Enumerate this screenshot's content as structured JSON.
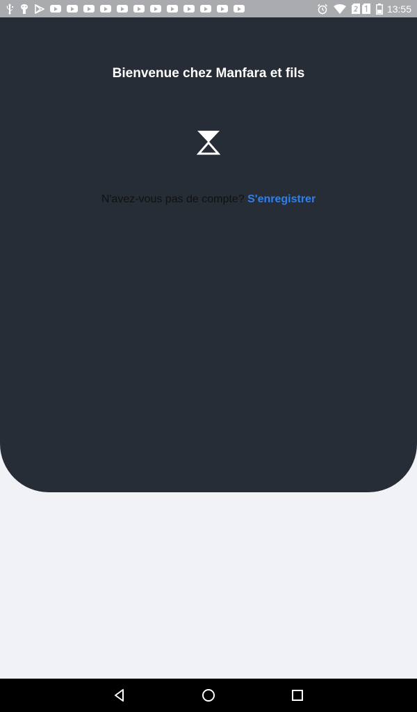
{
  "status_bar": {
    "time": "13:55",
    "left_icons": [
      "usb-icon",
      "android-debug-icon",
      "play-store-icon"
    ],
    "youtube_notification_count": 12,
    "right_icons": [
      "alarm-icon",
      "wifi-icon",
      "sim-2-icon",
      "sim-1-icon",
      "battery-icon"
    ]
  },
  "hero": {
    "title": "Bienvenue chez Manfara et fils",
    "loader_icon": "hourglass-icon"
  },
  "register": {
    "prompt": "N'avez-vous pas de compte? ",
    "link": "S'enregistrer"
  },
  "nav_bar": {
    "icons": [
      "back-icon",
      "home-icon",
      "recents-icon"
    ]
  },
  "colors": {
    "hero_bg": "#272d36",
    "page_bg": "#f1f2f6",
    "link": "#2f80ed",
    "status_bar": "#a9abaf"
  }
}
